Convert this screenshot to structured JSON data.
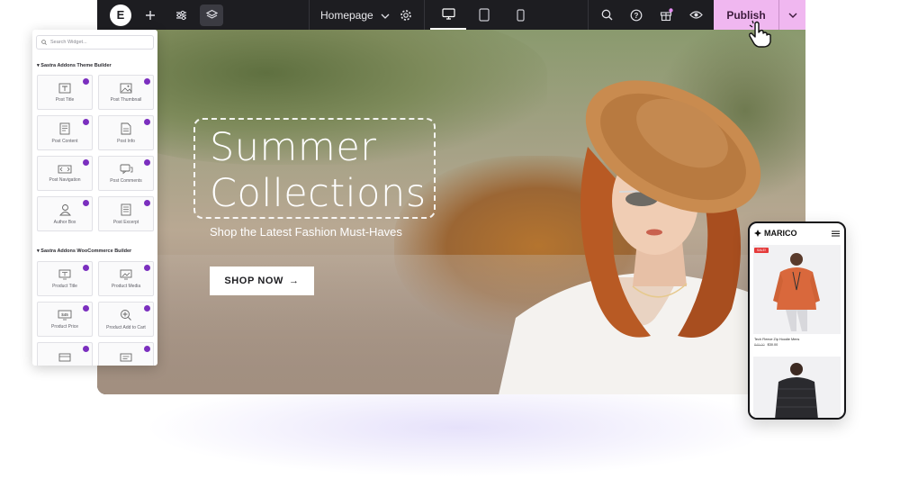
{
  "toolbar": {
    "logo": "E",
    "page_name": "Homepage",
    "publish_label": "Publish",
    "icons": [
      "elementor-logo",
      "add-icon",
      "sliders-icon",
      "layers-icon",
      "page-settings-icon",
      "desktop-icon",
      "tablet-icon",
      "mobile-icon",
      "search-icon",
      "help-icon",
      "gift-icon",
      "preview-eye-icon",
      "chevron-down-icon"
    ],
    "gift_badge_color": "#e38bf0",
    "publish_color": "#f0b7f0"
  },
  "hero": {
    "headline_1": "Summer",
    "headline_2": "Collections",
    "subheadline": "Shop the Latest Fashion Must-Haves",
    "cta_label": "SHOP NOW",
    "cta_arrow": "→"
  },
  "widgets": {
    "search_placeholder": "Search Widget...",
    "sections": [
      {
        "title": "Sastra Addons Theme Builder",
        "items": [
          {
            "label": "Post Title",
            "icon": "title-icon"
          },
          {
            "label": "Post Thumbnail",
            "icon": "image-icon"
          },
          {
            "label": "Post Content",
            "icon": "document-icon"
          },
          {
            "label": "Post Info",
            "icon": "info-doc-icon"
          },
          {
            "label": "Post Navigation",
            "icon": "navigation-icon"
          },
          {
            "label": "Post Comments",
            "icon": "comments-icon"
          },
          {
            "label": "Author Box",
            "icon": "author-icon"
          },
          {
            "label": "Post Excerpt",
            "icon": "excerpt-icon"
          }
        ]
      },
      {
        "title": "Sastra Addons WooCommerce Builder",
        "items": [
          {
            "label": "Product Title",
            "icon": "product-title-icon"
          },
          {
            "label": "Product Media",
            "icon": "product-media-icon"
          },
          {
            "label": "Product Price",
            "icon": "price-icon"
          },
          {
            "label": "Product Add to Cart",
            "icon": "add-to-cart-icon"
          },
          {
            "label": "",
            "icon": "product-widget-icon"
          },
          {
            "label": "",
            "icon": "product-widget-icon"
          }
        ]
      }
    ],
    "badge_color": "#7b2fbf"
  },
  "phone": {
    "brand": "MARICO",
    "sale_badge": "SALE!",
    "product_title": "Tech Fleece Zip Hoodie Mens",
    "old_price": "$45.00",
    "price": "$30.00"
  }
}
